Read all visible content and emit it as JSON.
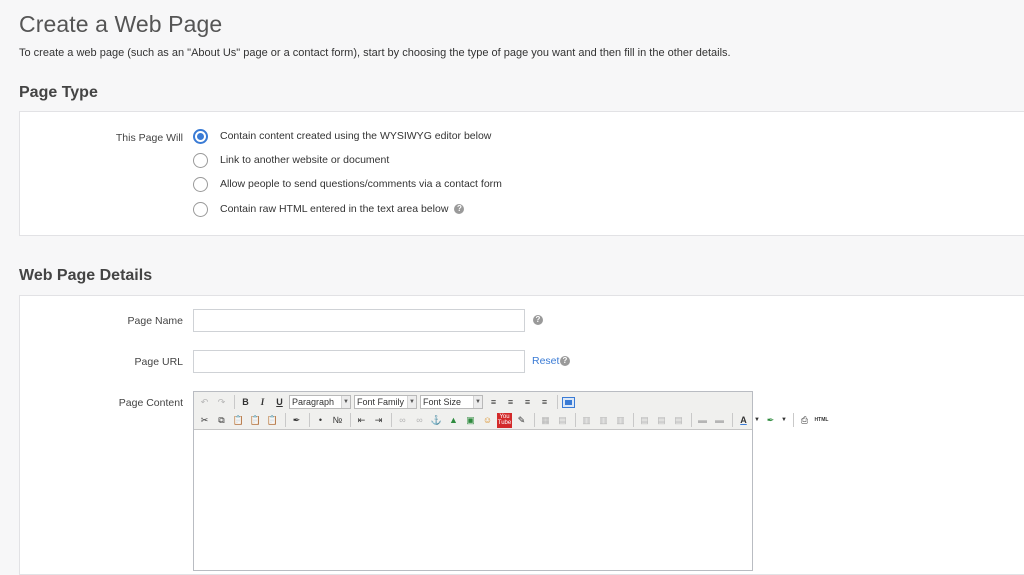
{
  "page": {
    "title": "Create a Web Page",
    "intro": "To create a web page (such as an \"About Us\" page or a contact form), start by choosing the type of page you want and then fill in the other details."
  },
  "page_type": {
    "heading": "Page Type",
    "label": "This Page Will",
    "options": [
      {
        "label": "Contain content created using the WYSIWYG editor below",
        "checked": true
      },
      {
        "label": "Link to another website or document",
        "checked": false
      },
      {
        "label": "Allow people to send questions/comments via a contact form",
        "checked": false
      },
      {
        "label": "Contain raw HTML entered in the text area below",
        "checked": false
      }
    ],
    "help": "?"
  },
  "details": {
    "heading": "Web Page Details",
    "page_name_label": "Page Name",
    "page_name_value": "",
    "page_url_label": "Page URL",
    "page_url_value": "",
    "reset_label": "Reset",
    "page_content_label": "Page Content",
    "help": "?"
  },
  "editor": {
    "bold": "B",
    "italic": "I",
    "underline": "U",
    "format_select": "Paragraph",
    "font_family_select": "Font Family",
    "font_size_select": "Font Size",
    "youtube_label": "You Tube",
    "html_label": "HTML",
    "text_color_label": "A"
  },
  "colors": {
    "accent": "#3a7bd5",
    "background": "#f7f7f8",
    "panel": "#ffffff"
  }
}
